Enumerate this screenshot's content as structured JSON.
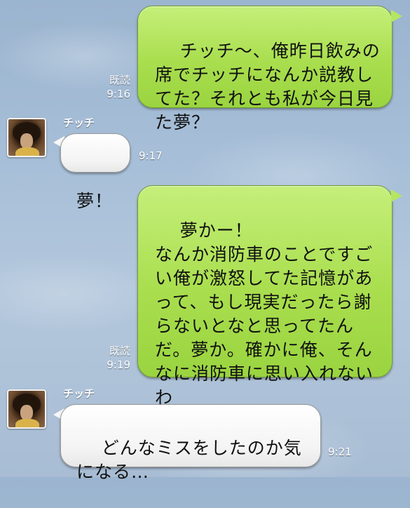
{
  "messages": [
    {
      "side": "out",
      "text": "チッチ〜、俺昨日飲みの席でチッチになんか説教してた？それとも私が今日見た夢？",
      "read_label": "既読",
      "time": "9:16"
    },
    {
      "side": "in",
      "sender": "チッチ",
      "text": "夢！",
      "time": "9:17"
    },
    {
      "side": "out",
      "text": "夢かー！\nなんか消防車のことですごい俺が激怒してた記憶があって、もし現実だったら謝らないとなと思ってたんだ。夢か。確かに俺、そんなに消防車に思い入れないわ",
      "read_label": "既読",
      "time": "9:19"
    },
    {
      "side": "in",
      "sender": "チッチ",
      "text": "どんなミスをしたのか気になる…",
      "time": "9:21"
    }
  ],
  "colors": {
    "outgoing_bubble": "#a9de4e",
    "incoming_bubble": "#ffffff",
    "background": "#a7bfd8"
  }
}
